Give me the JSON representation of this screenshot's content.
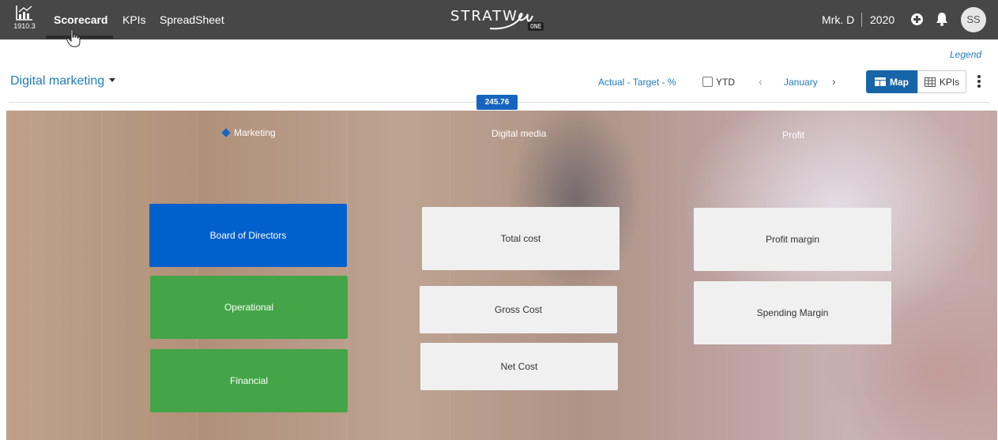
{
  "app": {
    "icon": "chart-bar-icon",
    "version": "1910.3",
    "brand_name": "STRATW",
    "brand_suffix": "ONE"
  },
  "nav": {
    "tabs": [
      {
        "label": "Scorecard",
        "active": true
      },
      {
        "label": "KPIs",
        "active": false
      },
      {
        "label": "SpreadSheet",
        "active": false
      }
    ]
  },
  "user": {
    "name": "Mrk. D",
    "year": "2020",
    "initials": "SS",
    "add_icon": "plus-circle-icon",
    "notifications_icon": "bell-icon"
  },
  "toolbar": {
    "legend_label": "Legend",
    "scorecard_name": "Digital marketing",
    "metric_mode": "Actual - Target - %",
    "ytd_label": "YTD",
    "ytd_checked": false,
    "prev_icon": "chevron-left-icon",
    "month": "January",
    "next_icon": "chevron-right-icon",
    "map_label": "Map",
    "kpis_label": "KPIs",
    "more_icon": "more-vertical-icon"
  },
  "map": {
    "score_badge": "245.76",
    "perspectives": [
      {
        "title": "Marketing",
        "selected": true
      },
      {
        "title": "Digital media",
        "selected": false
      },
      {
        "title": "Profit",
        "selected": false
      }
    ],
    "objectives": {
      "col1": [
        {
          "label": "Board of Directors",
          "status": "blue"
        },
        {
          "label": "Operational",
          "status": "green"
        },
        {
          "label": "Financial",
          "status": "green"
        }
      ],
      "col2": [
        {
          "label": "Total cost",
          "status": "none"
        },
        {
          "label": "Gross Cost",
          "status": "none"
        },
        {
          "label": "Net Cost",
          "status": "none"
        }
      ],
      "col3": [
        {
          "label": "Profit margin",
          "status": "none"
        },
        {
          "label": "Spending Margin",
          "status": "none"
        }
      ]
    },
    "colors": {
      "blue": "#0060cc",
      "green": "#43a547",
      "neutral": "#f0f0f0",
      "badge": "#1565c0"
    }
  }
}
